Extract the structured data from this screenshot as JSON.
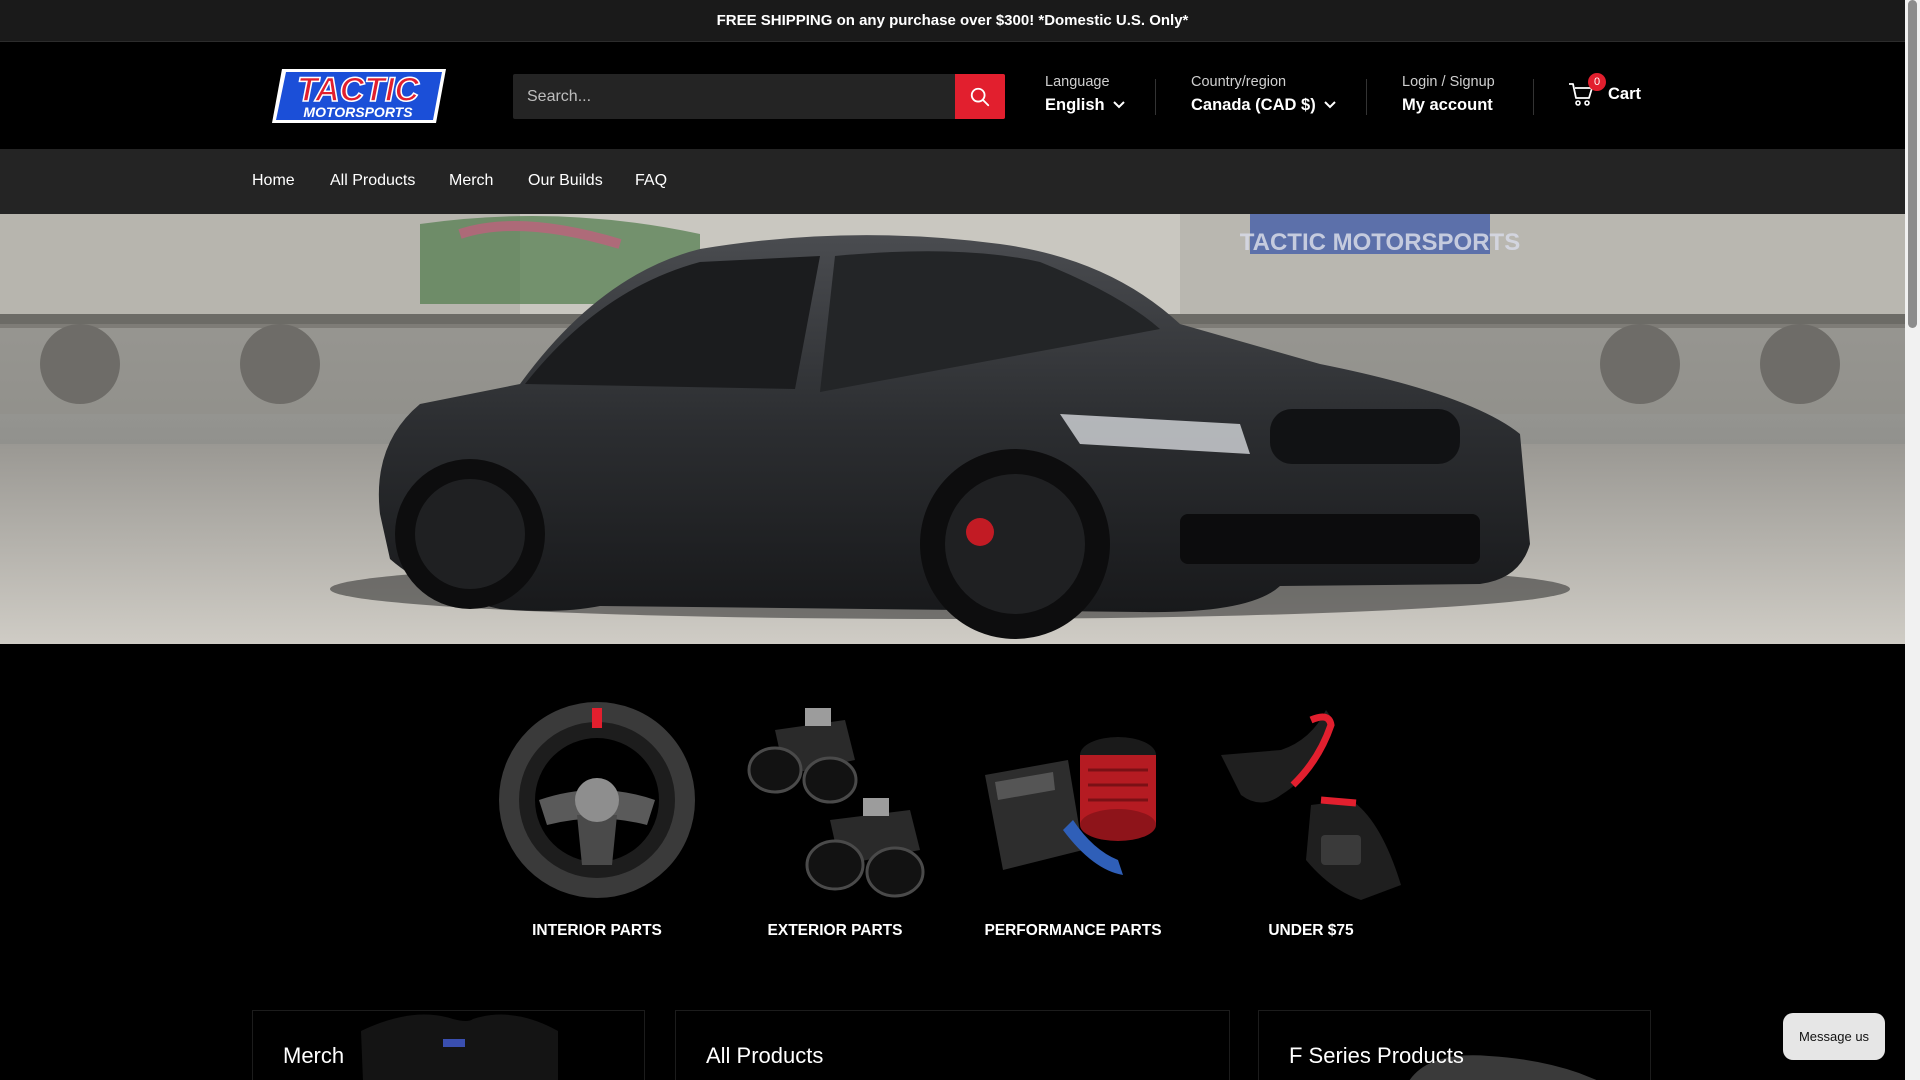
{
  "announcement": "FREE SHIPPING on any purchase over $300! *Domestic U.S. Only*",
  "brand": {
    "logo_top": "TACTIC",
    "logo_bottom": "MOTORSPORTS",
    "accent": "#e21f2e",
    "logo_blue": "#1b4fd8"
  },
  "search": {
    "placeholder": "Search..."
  },
  "language": {
    "label": "Language",
    "value": "English"
  },
  "country": {
    "label": "Country/region",
    "value": "Canada (CAD $)"
  },
  "account": {
    "label": "Login / Signup",
    "value": "My account"
  },
  "cart": {
    "count": "0",
    "label": "Cart"
  },
  "nav": [
    "Home",
    "All Products",
    "Merch",
    "Our Builds",
    "FAQ"
  ],
  "hero": {
    "banner_text": "TACTIC MOTORSPORTS"
  },
  "categories": [
    {
      "label": "INTERIOR PARTS",
      "icon": "steering-wheel-icon"
    },
    {
      "label": "EXTERIOR PARTS",
      "icon": "exhaust-tips-icon"
    },
    {
      "label": "PERFORMANCE PARTS",
      "icon": "air-intake-icon"
    },
    {
      "label": "UNDER $75",
      "icon": "paddle-shifters-icon"
    }
  ],
  "promos": [
    "Merch",
    "All Products",
    "F Series Products"
  ],
  "chat": {
    "label": "Message us"
  }
}
